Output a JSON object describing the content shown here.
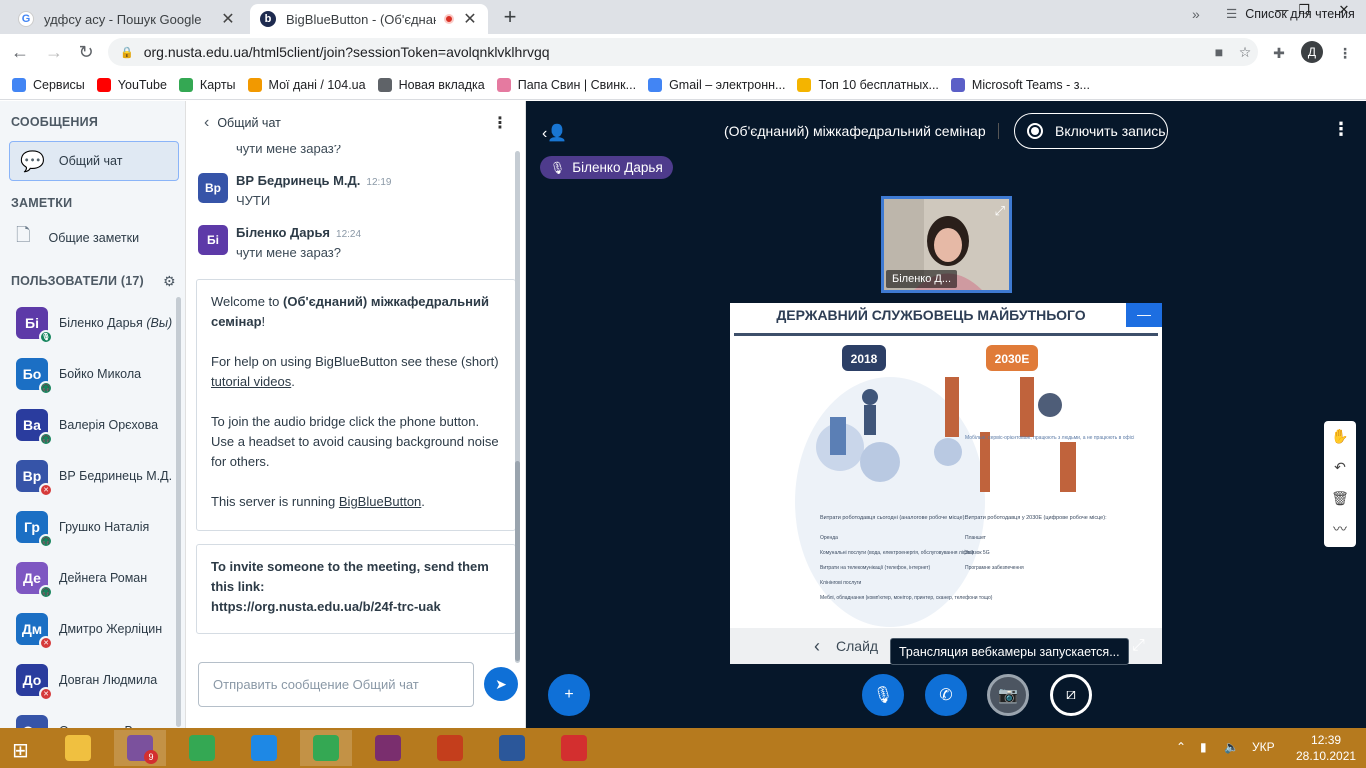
{
  "browser": {
    "tabs": [
      {
        "title": "удфсу асу - Пошук Google",
        "favicon": "google-icon"
      },
      {
        "title": "BigBlueButton - (Об'єднани",
        "favicon": "bbb-icon"
      }
    ],
    "url": "org.nusta.edu.ua/html5client/join?sessionToken=avolqnklvklhrvgq",
    "profile_initial": "Д",
    "bookmarks": [
      {
        "label": "Сервисы",
        "icon": "apps-grid-icon",
        "color": "#4285f4"
      },
      {
        "label": "YouTube",
        "icon": "youtube-icon",
        "color": "#ff0000"
      },
      {
        "label": "Карты",
        "icon": "maps-icon",
        "color": "#34a853"
      },
      {
        "label": "Мої дані / 104.ua",
        "icon": "104-icon",
        "color": "#f29900"
      },
      {
        "label": "Новая вкладка",
        "icon": "globe-icon",
        "color": "#5f6368"
      },
      {
        "label": "Папа Свин | Свинк...",
        "icon": "peppa-icon",
        "color": "#e57aa0"
      },
      {
        "label": "Gmail – электронн...",
        "icon": "google-icon",
        "color": "#4285f4"
      },
      {
        "label": "Топ 10 бесплатных...",
        "icon": "pen-icon",
        "color": "#f4b400"
      },
      {
        "label": "Microsoft Teams - з...",
        "icon": "teams-icon",
        "color": "#5b5fc7"
      }
    ],
    "reading_list": "Список для чтения"
  },
  "sidebar": {
    "messages_header": "СООБЩЕНИЯ",
    "public_chat": "Общий чат",
    "notes_header": "ЗАМЕТКИ",
    "shared_notes": "Общие заметки",
    "users_header": "ПОЛЬЗОВАТЕЛИ (17)",
    "users": [
      {
        "initials": "Бі",
        "name": "Біленко Дарья",
        "you": "(Вы)",
        "color": "#5d3aa8",
        "status": "mic"
      },
      {
        "initials": "Бо",
        "name": "Бойко Микола",
        "you": "",
        "color": "#1b6fc4",
        "status": "listen"
      },
      {
        "initials": "Ва",
        "name": "Валерія Орєхова",
        "you": "",
        "color": "#2a3c9e",
        "status": "listen"
      },
      {
        "initials": "Вр",
        "name": "ВР Бедринець М.Д.",
        "you": "",
        "color": "#3654a8",
        "status": "muted"
      },
      {
        "initials": "Гр",
        "name": "Грушко Наталія",
        "you": "",
        "color": "#1b6fc4",
        "status": "listen"
      },
      {
        "initials": "Де",
        "name": "Дейнега Роман",
        "you": "",
        "color": "#7e57c2",
        "status": "listen"
      },
      {
        "initials": "Дм",
        "name": "Дмитро Жерліцин",
        "you": "",
        "color": "#1b6fc4",
        "status": "muted"
      },
      {
        "initials": "До",
        "name": "Довган Людмила",
        "you": "",
        "color": "#2a3c9e",
        "status": "muted"
      },
      {
        "initials": "Ос",
        "name": "Осередчук Вадим",
        "you": "",
        "color": "#3654a8",
        "status": "listen"
      }
    ]
  },
  "chat": {
    "header": "Общий чат",
    "cut_text": "чути мене зараз?",
    "messages": [
      {
        "initials": "Вр",
        "author": "ВР Бедринець М.Д.",
        "time": "12:19",
        "text": "ЧУТИ"
      },
      {
        "initials": "Бі",
        "author": "Біленко Дарья",
        "time": "12:24",
        "text": "чути мене зараз?"
      }
    ],
    "welcome": {
      "line1_a": "Welcome to ",
      "line1_b": "(Об'єднаний) міжкафедральний семінар",
      "line1_c": "!",
      "help_a": "For help on using BigBlueButton see these (short) ",
      "help_link": "tutorial videos",
      "help_c": ".",
      "audio": "To join the audio bridge click the phone button. Use a headset to avoid causing background noise for others.",
      "server_a": "This server is running ",
      "server_link": "BigBlueButton",
      "server_c": "."
    },
    "invite_text": "To invite someone to the meeting, send them this link:",
    "invite_link": "https://org.nusta.edu.ua/b/24f-trc-uak",
    "input_placeholder": "Отправить сообщение Общий чат"
  },
  "meeting": {
    "title": "(Об'єднаний) міжкафедральний семінар",
    "record_label": "Включить запись",
    "talking": "Біленко Дарья",
    "webcam_name": "Біленко Д...",
    "slide_title": "ДЕРЖАВНИЙ СЛУЖБОВЕЦЬ МАЙБУТНЬОГО",
    "slide_nav_label": "Слайд",
    "tooltip": "Трансляция вебкамеры запускается...",
    "slide_left_year": "2018",
    "slide_right_year": "2030Е",
    "slide_left_caption": "Витрати роботодавця сьогодні (аналогове робоче місце):",
    "slide_right_caption": "Витрати роботодавця у 2030Е (цифрове робоче місце):",
    "slide_left_items": [
      "Оренда",
      "Комунальні послуги (вода, електроенергія, обслуговування ліфта)",
      "Витрати на телекомунікації (телефон, інтернет)",
      "Клінінгові послуги",
      "Меблі, обладнання (комп'ютер, монітор, принтер, сканер, телефони тощо)"
    ],
    "slide_right_items": [
      "Планшет",
      "Зв'язок 5G",
      "Програмне забезпечення"
    ],
    "slide_center_note": "Мобільні, сервіс-орієнтовані, працюють з людьми, а не працюють в офісі"
  },
  "taskbar": {
    "lang": "УКР",
    "time": "12:39",
    "date": "28.10.2021",
    "viber_badge": "9",
    "apps": [
      {
        "icon": "file-explorer-icon",
        "color": "#f0c040"
      },
      {
        "icon": "viber-icon",
        "color": "#7b519d"
      },
      {
        "icon": "chrome-icon",
        "color": "#34a853"
      },
      {
        "icon": "internet-explorer-icon",
        "color": "#1e88e5"
      },
      {
        "icon": "chrome-profile-icon",
        "color": "#34a853"
      },
      {
        "icon": "winrar-icon",
        "color": "#7a2e6e"
      },
      {
        "icon": "powerpoint-icon",
        "color": "#c43e1c"
      },
      {
        "icon": "word-icon",
        "color": "#2b579a"
      },
      {
        "icon": "acrobat-icon",
        "color": "#d32f2f"
      }
    ]
  }
}
